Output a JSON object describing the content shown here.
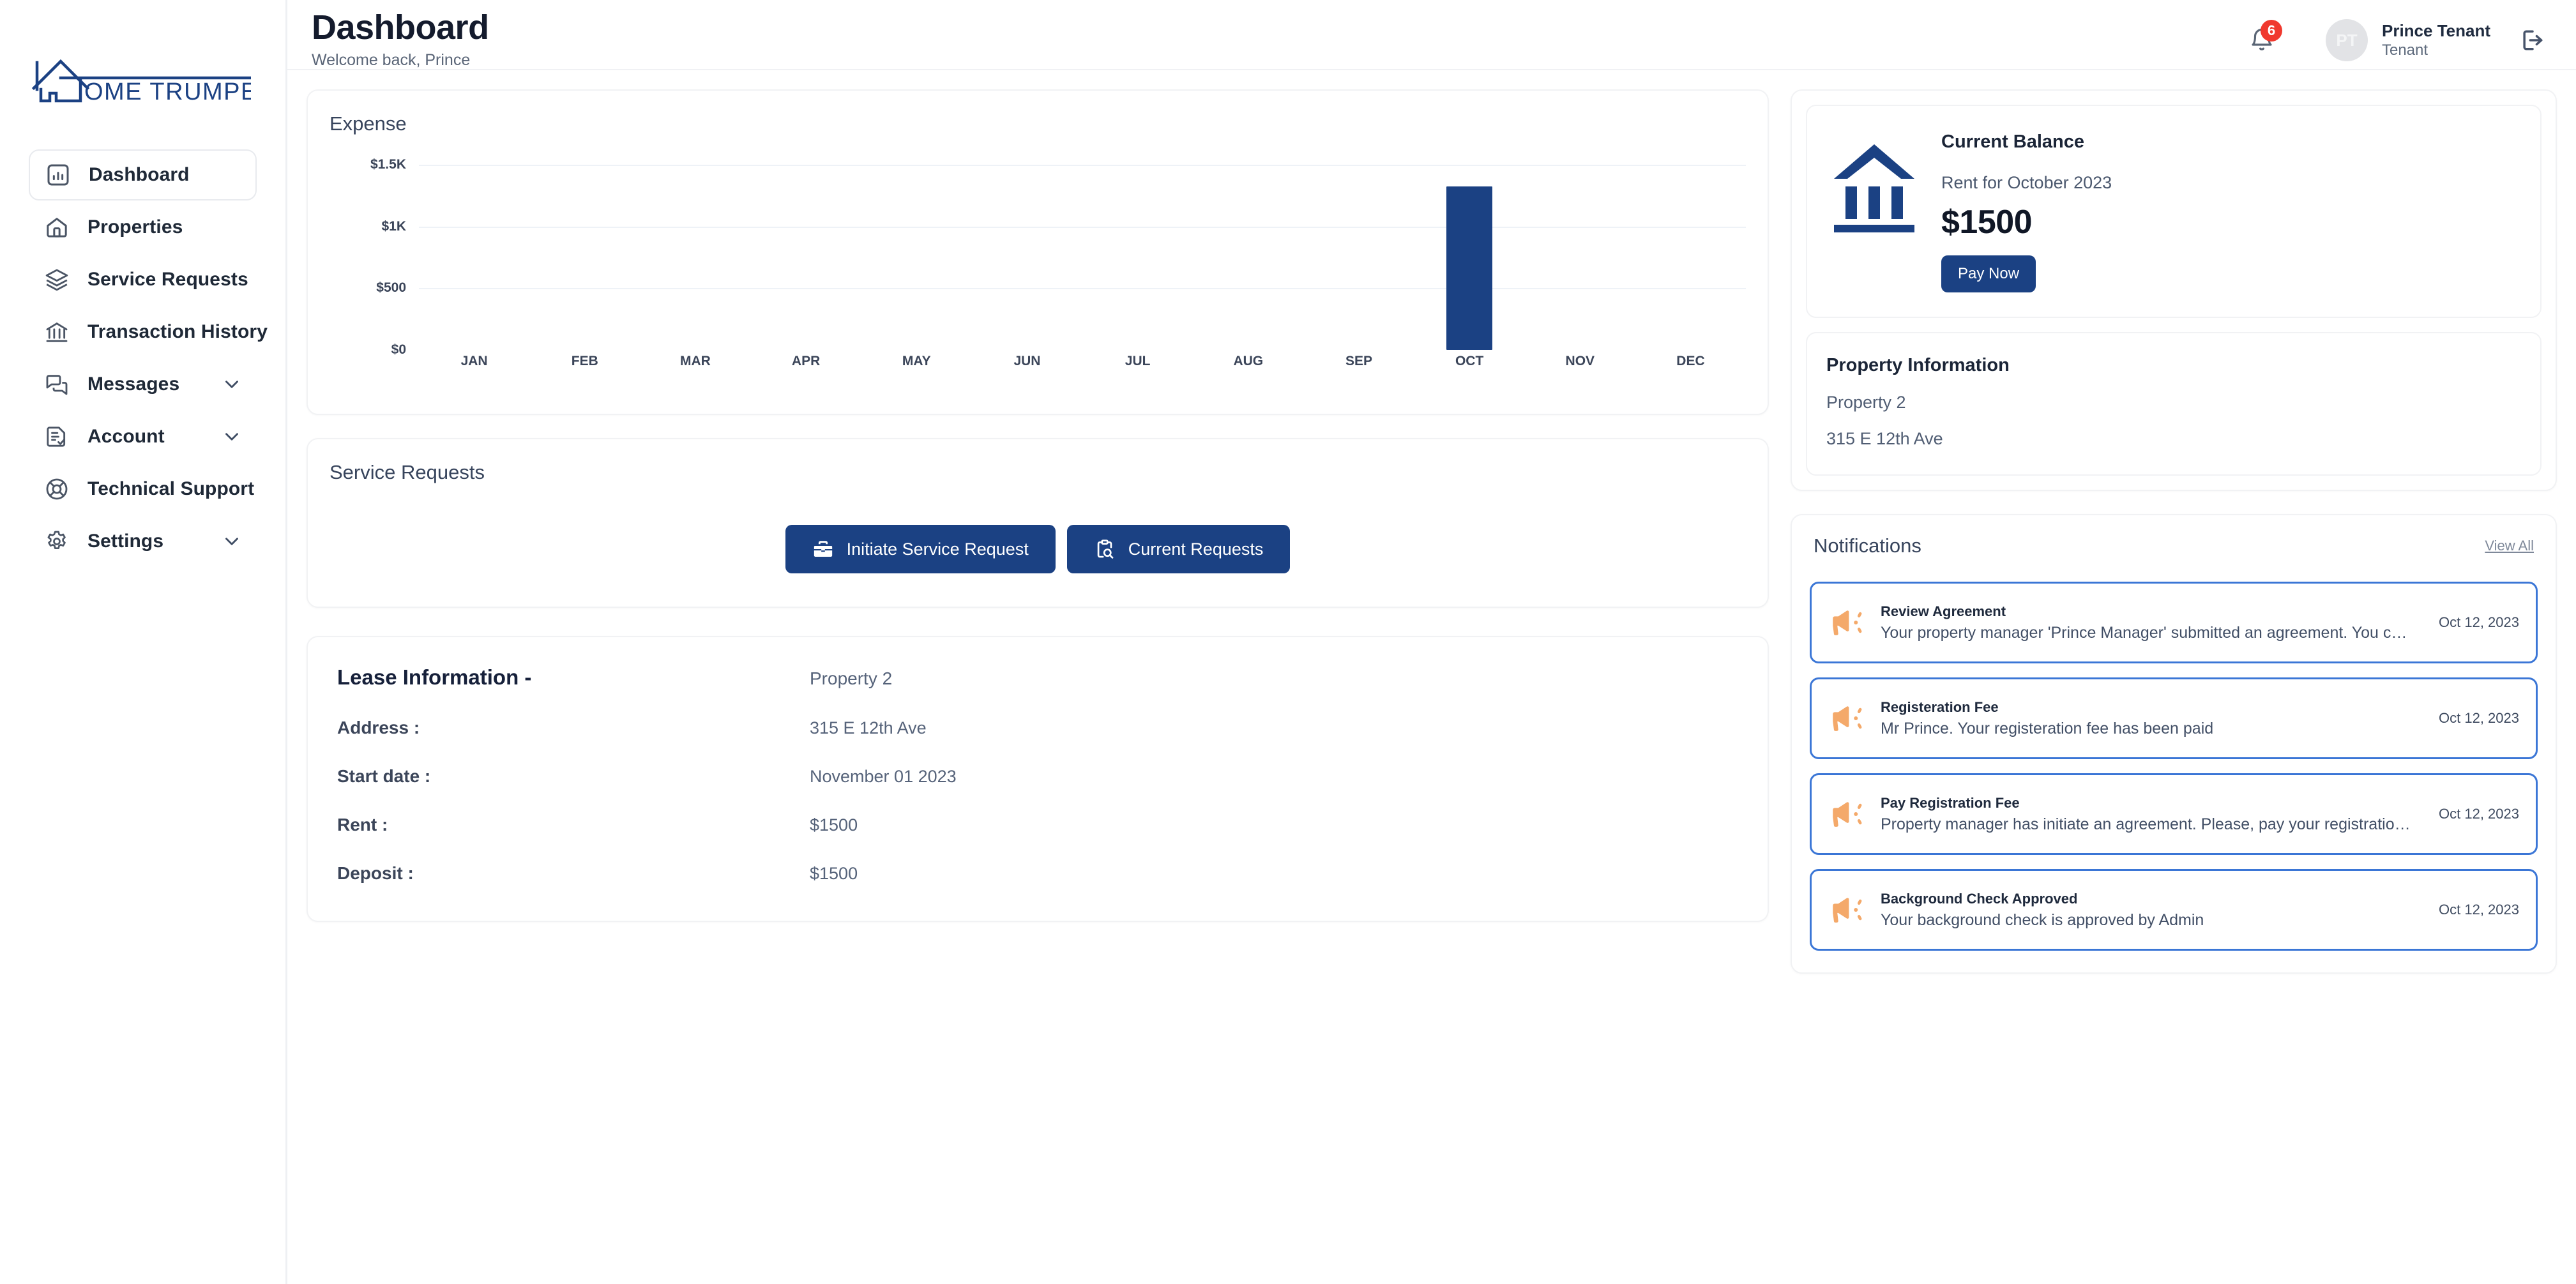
{
  "brand": {
    "logo_text": "OME TRUMPETER",
    "full_name": "HOME TRUMPETER",
    "color": "#1b4183"
  },
  "sidebar": {
    "items": [
      {
        "label": "Dashboard",
        "icon": "bar-chart-icon",
        "active": true,
        "expandable": false
      },
      {
        "label": "Properties",
        "icon": "home-icon",
        "active": false,
        "expandable": false
      },
      {
        "label": "Service Requests",
        "icon": "layers-icon",
        "active": false,
        "expandable": false
      },
      {
        "label": "Transaction History",
        "icon": "bank-icon",
        "active": false,
        "expandable": false
      },
      {
        "label": "Messages",
        "icon": "chat-icon",
        "active": false,
        "expandable": true
      },
      {
        "label": "Account",
        "icon": "document-check-icon",
        "active": false,
        "expandable": true
      },
      {
        "label": "Technical Support",
        "icon": "lifebuoy-icon",
        "active": false,
        "expandable": false
      },
      {
        "label": "Settings",
        "icon": "gear-icon",
        "active": false,
        "expandable": true
      }
    ]
  },
  "header": {
    "title": "Dashboard",
    "subtitle": "Welcome back, Prince",
    "notification_count": "6",
    "avatar_initials": "PT",
    "user_name": "Prince Tenant",
    "user_role": "Tenant"
  },
  "expense": {
    "title": "Expense"
  },
  "chart_data": {
    "type": "bar",
    "title": "Expense",
    "xlabel": "",
    "ylabel": "",
    "categories": [
      "JAN",
      "FEB",
      "MAR",
      "APR",
      "MAY",
      "JUN",
      "JUL",
      "AUG",
      "SEP",
      "OCT",
      "NOV",
      "DEC"
    ],
    "values": [
      0,
      0,
      0,
      0,
      0,
      0,
      0,
      0,
      0,
      1500,
      0,
      0
    ],
    "ytick_labels": [
      "$0",
      "$500",
      "$1K",
      "$1.5K"
    ],
    "ytick_values": [
      0,
      500,
      1000,
      1500
    ],
    "ylim": [
      0,
      1700
    ],
    "grid": true,
    "gridline_values": [
      500,
      1000,
      1500
    ],
    "legend": "none",
    "bar_color": "#1b4183"
  },
  "service_requests": {
    "title": "Service Requests",
    "initiate_label": "Initiate Service Request",
    "current_label": "Current Requests"
  },
  "lease": {
    "heading": "Lease Information -",
    "heading_value": "Property 2",
    "rows": [
      {
        "label": "Address :",
        "value": "315 E 12th Ave"
      },
      {
        "label": "Start date :",
        "value": "November 01 2023"
      },
      {
        "label": "Rent :",
        "value": "$1500"
      },
      {
        "label": "Deposit :",
        "value": "$1500"
      }
    ]
  },
  "balance": {
    "title": "Current Balance",
    "period": "Rent for October 2023",
    "amount": "$1500",
    "pay_label": "Pay Now"
  },
  "property_info": {
    "title": "Property Information",
    "name": "Property 2",
    "address": "315 E 12th Ave"
  },
  "notifications": {
    "title": "Notifications",
    "view_all": "View All",
    "items": [
      {
        "title": "Review Agreement",
        "message": "Your property manager 'Prince Manager' submitted an agreement. You can r…",
        "date": "Oct 12, 2023"
      },
      {
        "title": "Registeration Fee",
        "message": "Mr Prince. Your registeration fee has been paid",
        "date": "Oct 12, 2023"
      },
      {
        "title": "Pay Registration Fee",
        "message": "Property manager has initiate an agreement. Please, pay your registration fe…",
        "date": "Oct 12, 2023"
      },
      {
        "title": "Background Check Approved",
        "message": "Your background check is approved by Admin",
        "date": "Oct 12, 2023"
      }
    ]
  }
}
